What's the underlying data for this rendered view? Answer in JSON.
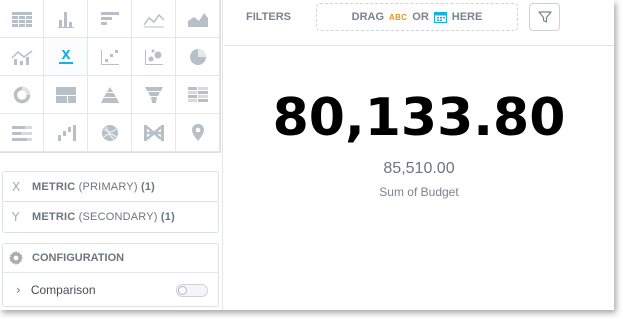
{
  "chart_types": [
    {
      "icon": "table-icon"
    },
    {
      "icon": "column-chart-icon"
    },
    {
      "icon": "bar-chart-icon"
    },
    {
      "icon": "line-chart-icon"
    },
    {
      "icon": "area-chart-icon"
    },
    {
      "icon": "combo-chart-icon"
    },
    {
      "icon": "headline-icon",
      "selected": true
    },
    {
      "icon": "scatter-plot-icon"
    },
    {
      "icon": "bubble-chart-icon"
    },
    {
      "icon": "pie-chart-icon"
    },
    {
      "icon": "donut-chart-icon"
    },
    {
      "icon": "treemap-icon"
    },
    {
      "icon": "pyramid-icon"
    },
    {
      "icon": "funnel-chart-icon"
    },
    {
      "icon": "heatmap-icon"
    },
    {
      "icon": "bullet-chart-icon"
    },
    {
      "icon": "waterfall-chart-icon"
    },
    {
      "icon": "dependency-wheel-icon"
    },
    {
      "icon": "sankey-icon"
    },
    {
      "icon": "geo-chart-icon"
    }
  ],
  "buckets": {
    "primary": {
      "letter": "X",
      "title": "METRIC",
      "sub": "(PRIMARY)",
      "count": "(1)"
    },
    "secondary": {
      "letter": "Y",
      "title": "METRIC",
      "sub": "(SECONDARY)",
      "count": "(1)"
    }
  },
  "configuration": {
    "title": "CONFIGURATION",
    "comparison_label": "Comparison",
    "comparison_enabled": false
  },
  "filters": {
    "label": "FILTERS",
    "drag_prefix": "DRAG",
    "abc": "ABC",
    "or": "OR",
    "here": "HERE"
  },
  "headline": {
    "primary_value": "80,133.80",
    "secondary_value": "85,510.00",
    "secondary_label": "Sum of Budget"
  },
  "colors": {
    "accent": "#14b2e2",
    "icon_gray": "#b8bfc7",
    "abc_orange": "#e8941a"
  }
}
